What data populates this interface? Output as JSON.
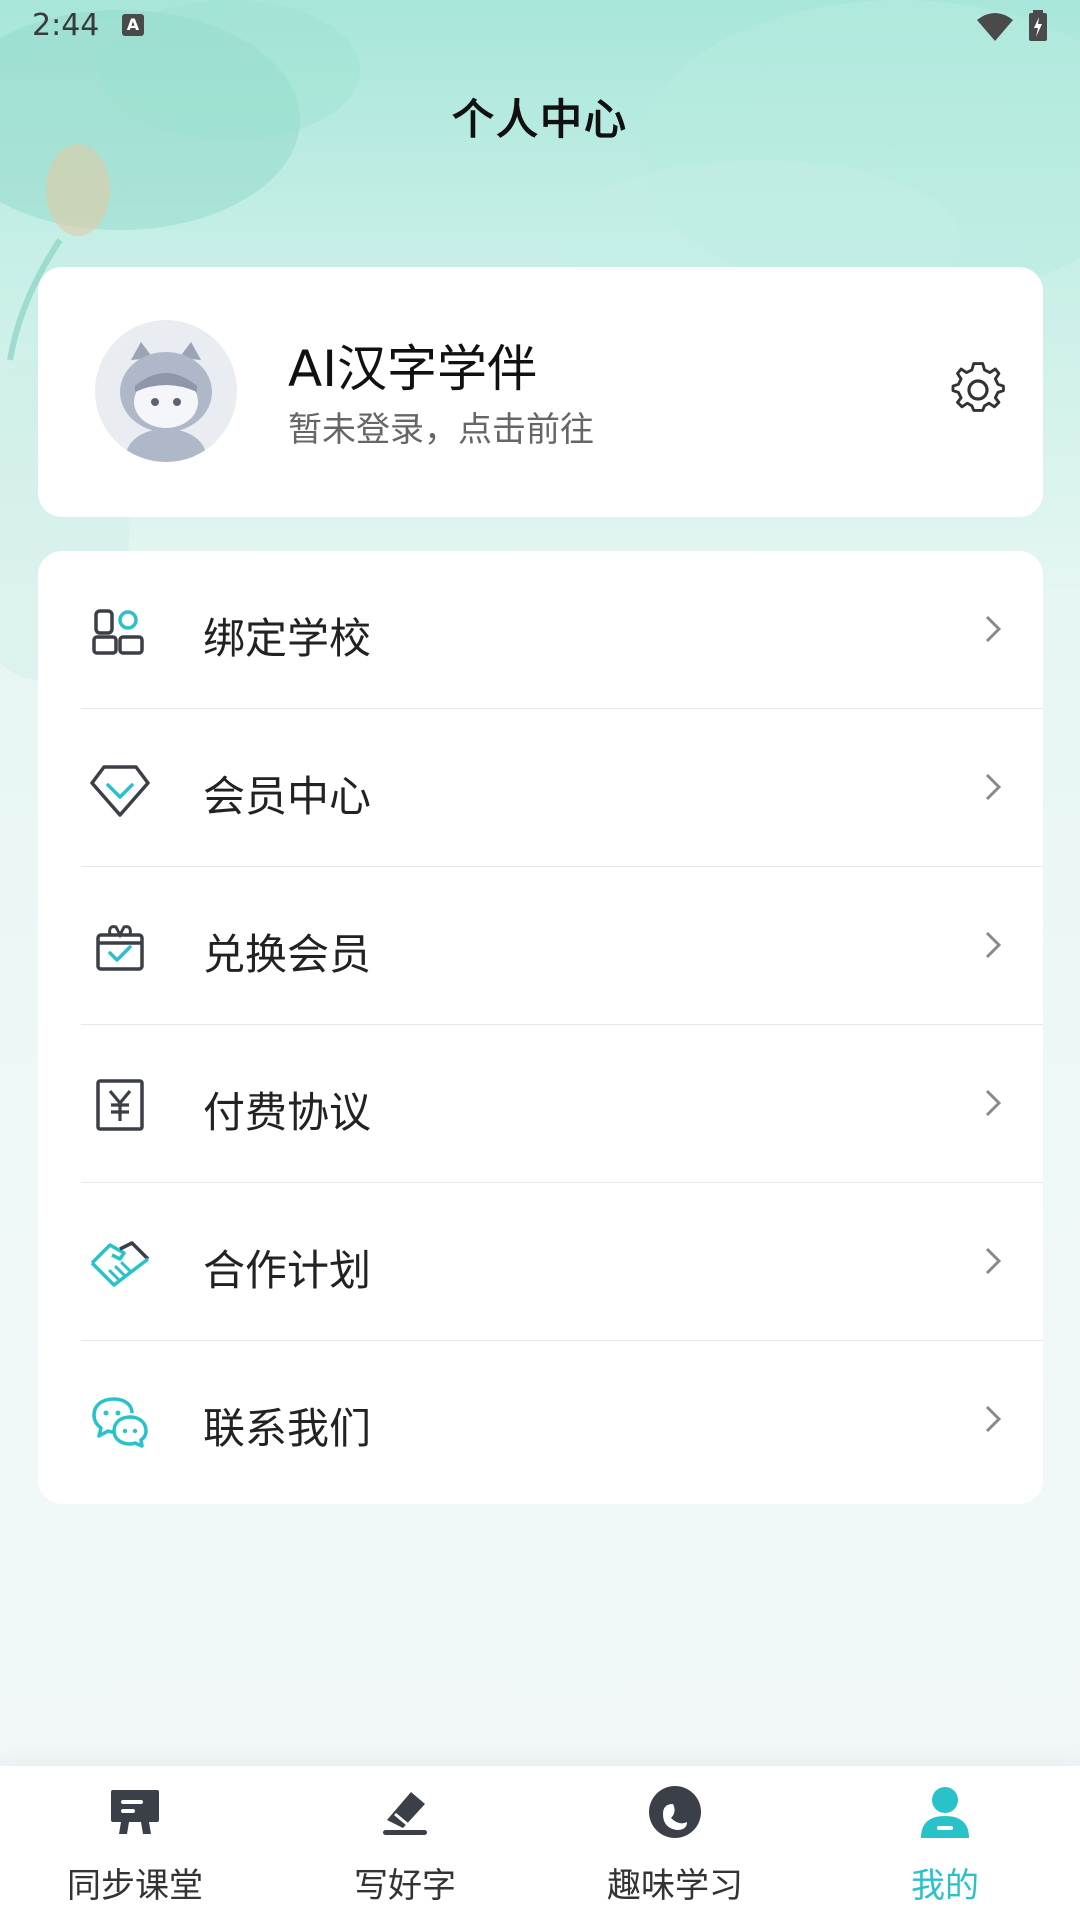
{
  "status_bar": {
    "time": "2:44",
    "keyboard_badge": "A"
  },
  "header": {
    "title": "个人中心"
  },
  "profile": {
    "name": "AI汉字学伴",
    "subtitle": "暂未登录，点击前往"
  },
  "menu": {
    "items": [
      {
        "label": "绑定学校",
        "icon": "school-bind-icon"
      },
      {
        "label": "会员中心",
        "icon": "diamond-vip-icon"
      },
      {
        "label": "兑换会员",
        "icon": "gift-redeem-icon"
      },
      {
        "label": "付费协议",
        "icon": "yen-document-icon"
      },
      {
        "label": "合作计划",
        "icon": "handshake-icon"
      },
      {
        "label": "联系我们",
        "icon": "chat-bubbles-icon"
      }
    ]
  },
  "bottom_nav": {
    "items": [
      {
        "label": "同步课堂",
        "icon": "classroom-icon",
        "active": false
      },
      {
        "label": "写好字",
        "icon": "write-eraser-icon",
        "active": false
      },
      {
        "label": "趣味学习",
        "icon": "fun-learning-icon",
        "active": false
      },
      {
        "label": "我的",
        "icon": "profile-person-icon",
        "active": true
      }
    ]
  },
  "colors": {
    "accent": "#29c2c9",
    "icon_dark": "#3b3f47",
    "header_bg": "#a8e6da"
  }
}
